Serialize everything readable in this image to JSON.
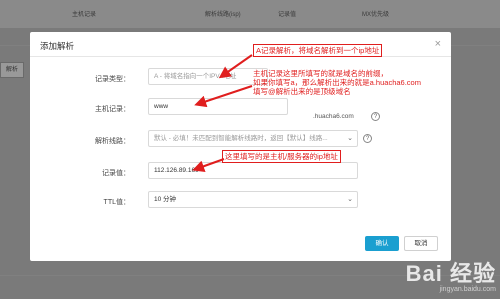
{
  "background": {
    "columns": [
      "主机记录",
      "解析线路(isp)",
      "记录值",
      "MX优先级"
    ],
    "left_button": "解析"
  },
  "dialog": {
    "title": "添加解析",
    "record_type": {
      "label": "记录类型：",
      "value": "A - 将域名指向一个IPV4地址"
    },
    "host": {
      "label": "主机记录：",
      "value": "www",
      "suffix": ".huacha6.com"
    },
    "line": {
      "label": "解析线路：",
      "value": "默认 - 必填！未匹配到智能解析线路时，返回【默认】线路..."
    },
    "record_value": {
      "label": "记录值：",
      "value": "112.126.89.169"
    },
    "ttl": {
      "label": "TTL值：",
      "value": "10 分钟"
    },
    "confirm_label": "确认",
    "cancel_label": "取消"
  },
  "annotations": {
    "a_record": "A记录解析，将域名解析到一个ip地址",
    "host_note": [
      "主机记录这里所填写的就是域名的前缀，",
      "如果你填写a，那么解析出来的就是a.huacha6.com",
      "填写@解析出来的是顶级域名"
    ],
    "value_note": "这里填写的是主机/服务器的ip地址"
  },
  "watermark": {
    "main": "Bai 经验",
    "sub": "jingyan.baidu.com"
  },
  "colors": {
    "annotation": "#e01e1e",
    "confirm": "#1a9fd0",
    "overlay": "#7a7a7a"
  }
}
